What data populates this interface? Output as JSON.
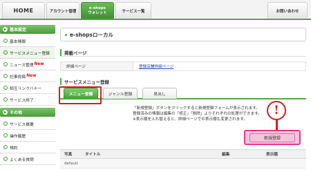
{
  "nav": {
    "home": "HOME",
    "account": "アカウント管理",
    "eshops_line1": "e-shops",
    "eshops_line2": "ウォレット",
    "services": "サービス一覧",
    "contact": "お問い合わせ"
  },
  "sidebar": {
    "section1": "基本設定",
    "items1": [
      {
        "label": "基本情報",
        "new": ""
      },
      {
        "label": "サービスメニュー登録",
        "new": ""
      },
      {
        "label": "ニュース管理",
        "new": "New"
      },
      {
        "label": "記事投稿",
        "new": "New"
      },
      {
        "label": "相互リンクバナー",
        "new": ""
      },
      {
        "label": "サービス終了",
        "new": ""
      }
    ],
    "section2": "その他",
    "items2": [
      {
        "label": "サービス概要"
      },
      {
        "label": "操作履歴"
      },
      {
        "label": "規約"
      },
      {
        "label": "よくある質問"
      }
    ]
  },
  "main": {
    "title": "e-shopsローカル",
    "posting_label": "掲載ページ",
    "detail_key": "詳細ページ",
    "detail_link": "登録店舗詳細ページ",
    "menu_reg_label": "サービスメニュー登録",
    "tabs": [
      "メニュー登録",
      "ジャンル登録",
      "見出し"
    ],
    "info": [
      "「新規登録」ボタンをクリックすると新規登録フォームが表示されます。",
      "登録済みの情報は編集の「修正」「削除」よりそれぞれの処理ができます。",
      "※表示順を入れ替えると、詳細ページでの表示順も変更されます。"
    ],
    "add_button": "新規登録",
    "table": {
      "headers": [
        "写真",
        "タイトル",
        "編集",
        "表示順"
      ],
      "rows": [
        [
          "default",
          "",
          "",
          ""
        ]
      ]
    },
    "alert_mark": "!"
  }
}
